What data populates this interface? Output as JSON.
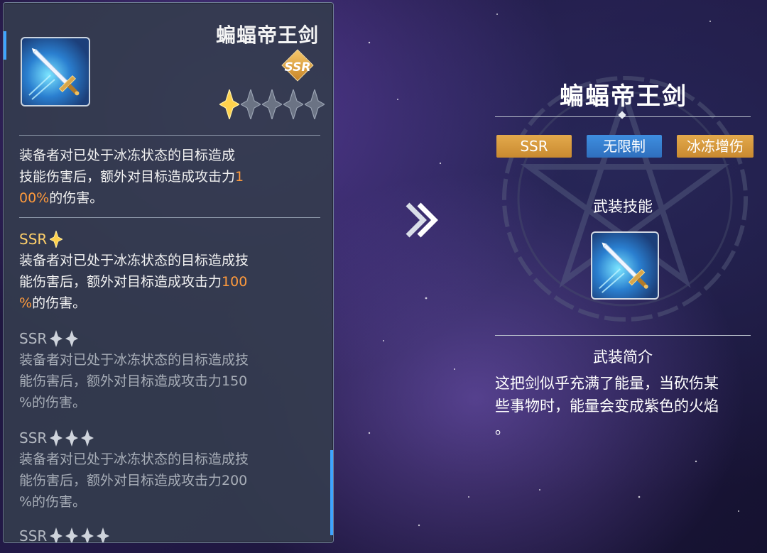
{
  "weapon": {
    "name": "蝙蝠帝王剑",
    "rarity": "SSR",
    "stars_active": 1,
    "stars_total": 5
  },
  "left_panel": {
    "base_desc": [
      "装备者对已处于冰冻状态的目标造成",
      "技能伤害后，额外对目标造成攻击力",
      "1",
      "00%",
      "的伤害。"
    ],
    "tiers": [
      {
        "label": "SSR",
        "stars": 1,
        "active": true,
        "line1": "装备者对已处于冰冻状态的目标造成技",
        "line2a": "能伤害后，额外对目标造成攻击力",
        "value_a": "100",
        "value_b": "%",
        "tail": "的伤害。"
      },
      {
        "label": "SSR",
        "stars": 2,
        "active": false,
        "line1": "装备者对已处于冰冻状态的目标造成技",
        "line2a": "能伤害后，额外对目标造成攻击力150",
        "line3": "%的伤害。"
      },
      {
        "label": "SSR",
        "stars": 3,
        "active": false,
        "line1": "装备者对已处于冰冻状态的目标造成技",
        "line2a": "能伤害后，额外对目标造成攻击力200",
        "line3": "%的伤害。"
      },
      {
        "label": "SSR",
        "stars": 4,
        "active": false
      }
    ]
  },
  "right_panel": {
    "title": "蝙蝠帝王剑",
    "tags": [
      "SSR",
      "无限制",
      "冰冻增伤"
    ],
    "skill_heading": "武装技能",
    "intro_heading": "武装简介",
    "intro_lines": [
      "这把剑似乎充满了能量，当砍伤某",
      "些事物时，能量会变成紫色的火焰",
      "。"
    ]
  },
  "colors": {
    "accent_blue": "#3ea4ff",
    "highlight_orange": "#ff9a3c",
    "tag_gold": "#d89a3e",
    "tag_blue": "#3580d0"
  },
  "icons": [
    "sword-icon",
    "star-icon",
    "double-chevron-icon",
    "pentagram-emblem"
  ]
}
